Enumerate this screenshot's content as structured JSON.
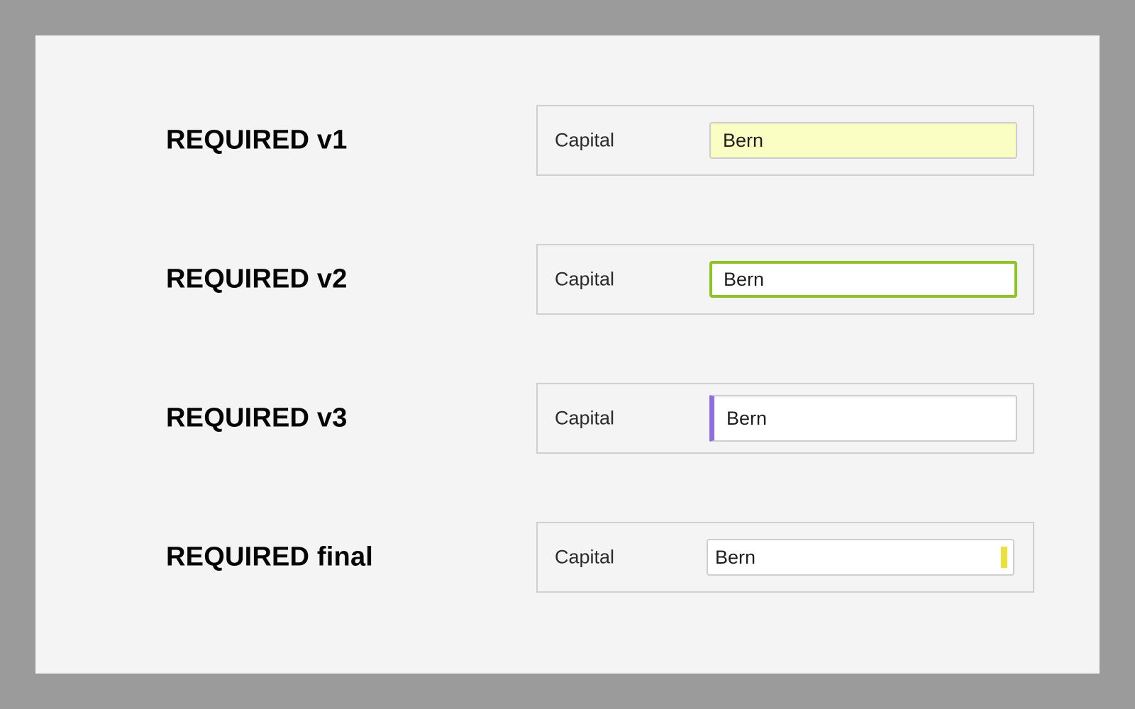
{
  "variants": [
    {
      "heading": "REQUIRED v1",
      "label": "Capital",
      "value": "Bern",
      "style": "yellow-fill",
      "accent_color": "#fbfec2"
    },
    {
      "heading": "REQUIRED v2",
      "label": "Capital",
      "value": "Bern",
      "style": "green-border",
      "accent_color": "#8dc322"
    },
    {
      "heading": "REQUIRED v3",
      "label": "Capital",
      "value": "Bern",
      "style": "purple-left-bar",
      "accent_color": "#8f6fdf"
    },
    {
      "heading": "REQUIRED final",
      "label": "Capital",
      "value": "Bern",
      "style": "yellow-right-marker",
      "accent_color": "#ebe13a"
    }
  ]
}
